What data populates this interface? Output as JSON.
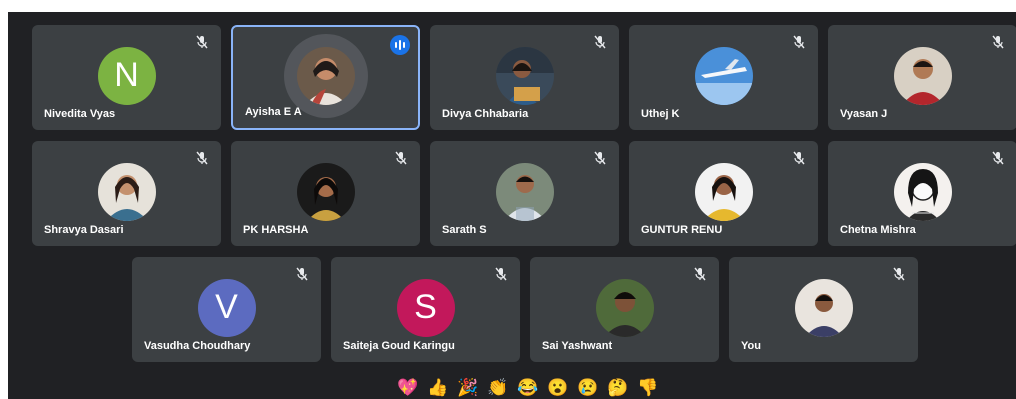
{
  "participants": [
    {
      "name": "Nivedita Vyas",
      "initial": "N",
      "color": "#7cb342"
    },
    {
      "name": "Ayisha E A"
    },
    {
      "name": "Divya Chhabaria"
    },
    {
      "name": "Uthej K"
    },
    {
      "name": "Vyasan J"
    },
    {
      "name": "Shravya Dasari"
    },
    {
      "name": "PK HARSHA"
    },
    {
      "name": "Sarath S"
    },
    {
      "name": "GUNTUR RENU"
    },
    {
      "name": "Chetna Mishra"
    },
    {
      "name": "Vasudha Choudhary",
      "initial": "V",
      "color": "#5c6bc0"
    },
    {
      "name": "Saiteja Goud Karingu",
      "initial": "S",
      "color": "#c2185b"
    },
    {
      "name": "Sai Yashwant"
    },
    {
      "name": "You"
    }
  ],
  "reactions": [
    {
      "icon": "sparkling-heart-icon",
      "glyph": "💖"
    },
    {
      "icon": "thumbs-up-icon",
      "glyph": "👍"
    },
    {
      "icon": "party-popper-icon",
      "glyph": "🎉"
    },
    {
      "icon": "clapping-hands-icon",
      "glyph": "👏"
    },
    {
      "icon": "tears-of-joy-icon",
      "glyph": "😂"
    },
    {
      "icon": "surprised-face-icon",
      "glyph": "😮"
    },
    {
      "icon": "sad-face-icon",
      "glyph": "😢"
    },
    {
      "icon": "thinking-face-icon",
      "glyph": "🤔"
    },
    {
      "icon": "thumbs-down-icon",
      "glyph": "👎"
    }
  ],
  "colors": {
    "background": "#202124",
    "tile": "#3c4043",
    "speaking_border": "#8ab4f8",
    "active_mic": "#1a73e8"
  }
}
